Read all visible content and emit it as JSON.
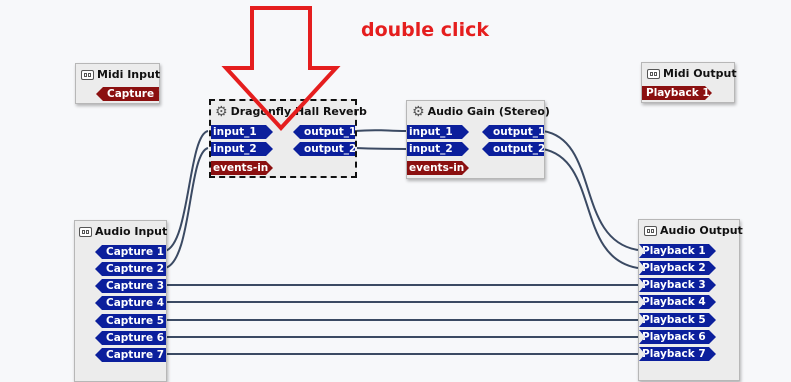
{
  "annotation": {
    "text": "double click"
  },
  "nodes": {
    "midi_input": {
      "title": "Midi Input",
      "ports": [
        "Capture 1"
      ]
    },
    "midi_output": {
      "title": "Midi Output",
      "ports": [
        "Playback 1"
      ]
    },
    "reverb": {
      "title": "Dragonfly Hall Reverb",
      "inputs": [
        "input_1",
        "input_2"
      ],
      "outputs": [
        "output_1",
        "output_2"
      ],
      "events": "events-in"
    },
    "gain": {
      "title": "Audio Gain (Stereo)",
      "inputs": [
        "input_1",
        "input_2"
      ],
      "outputs": [
        "output_1",
        "output_2"
      ],
      "events": "events-in"
    },
    "audio_input": {
      "title": "Audio Input",
      "ports": [
        "Capture 1",
        "Capture 2",
        "Capture 3",
        "Capture 4",
        "Capture 5",
        "Capture 6",
        "Capture 7"
      ]
    },
    "audio_output": {
      "title": "Audio Output",
      "ports": [
        "Playback 1",
        "Playback 2",
        "Playback 3",
        "Playback 4",
        "Playback 5",
        "Playback 6",
        "Playback 7"
      ]
    }
  },
  "colors": {
    "audio_port": "#0b1f9c",
    "midi_port": "#8b1010",
    "connection": "#3b4a63",
    "annotation": "#e51e1e"
  },
  "icons": {
    "module": "gear-icon",
    "system": "ports-icon"
  }
}
